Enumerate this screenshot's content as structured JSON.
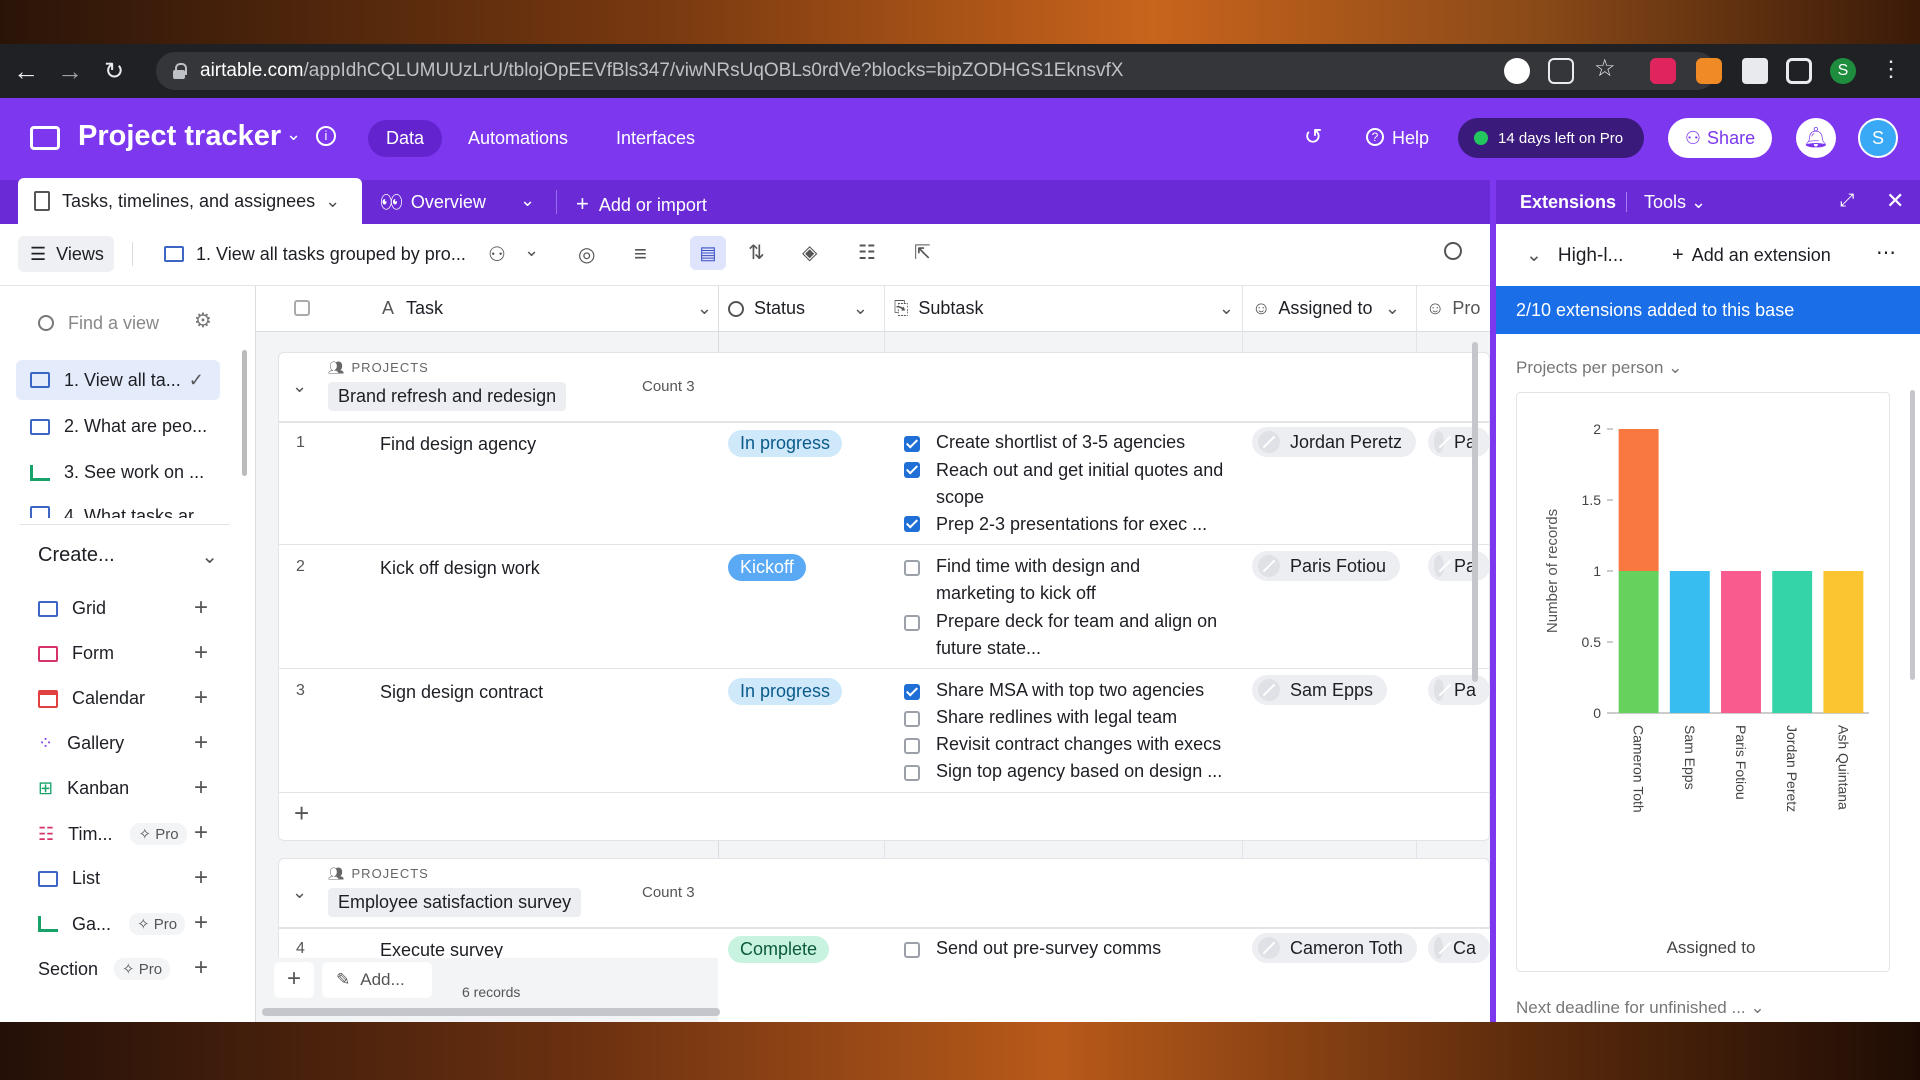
{
  "browser": {
    "url_domain": "airtable.com",
    "url_path": "/appIdhCQLUMUUzLrU/tblojOpEEVfBls347/viwNRsUqOBLs0rdVe?blocks=bipZODHGS1EknsvfX"
  },
  "app": {
    "base_name": "Project tracker",
    "nav": [
      "Data",
      "Automations",
      "Interfaces"
    ],
    "help": "Help",
    "trial": "14 days left on Pro",
    "share": "Share",
    "avatar": "S"
  },
  "tabs": {
    "active": "Tasks, timelines, and assignees",
    "overview": "Overview",
    "add": "Add or import"
  },
  "toolbar": {
    "views": "Views",
    "current_view": "1. View all tasks grouped by pro..."
  },
  "sidebar": {
    "find_placeholder": "Find a view",
    "views": [
      "1. View all ta...",
      "2. What are peo...",
      "3. See work on ...",
      "4. What tasks ar..."
    ],
    "create": "Create...",
    "create_items": [
      {
        "label": "Grid",
        "pro": ""
      },
      {
        "label": "Form",
        "pro": ""
      },
      {
        "label": "Calendar",
        "pro": ""
      },
      {
        "label": "Gallery",
        "pro": ""
      },
      {
        "label": "Kanban",
        "pro": ""
      },
      {
        "label": "Tim...",
        "pro": "Pro"
      },
      {
        "label": "List",
        "pro": ""
      },
      {
        "label": "Ga...",
        "pro": "Pro"
      },
      {
        "label": "Section",
        "pro": "Pro"
      }
    ]
  },
  "grid": {
    "columns": [
      "Task",
      "Status",
      "Subtask",
      "Assigned to",
      "Pro"
    ],
    "groups": [
      {
        "kind": "PROJECTS",
        "name": "Brand refresh and redesign",
        "count": "Count 3"
      },
      {
        "kind": "PROJECTS",
        "name": "Employee satisfaction survey",
        "count": "Count 3"
      }
    ],
    "rows": [
      {
        "num": "1",
        "task": "Find design agency",
        "status": "In progress",
        "assignee": "Jordan Peretz",
        "proj": "Pa",
        "subtasks": [
          {
            "text": "Create shortlist of 3-5 agencies",
            "done": true
          },
          {
            "text": "Reach out and get initial quotes and",
            "done": true
          },
          {
            "text": "scope",
            "done": null
          },
          {
            "text": "Prep 2-3 presentations for exec ...",
            "done": true
          }
        ]
      },
      {
        "num": "2",
        "task": "Kick off design work",
        "status": "Kickoff",
        "assignee": "Paris Fotiou",
        "proj": "Pa",
        "subtasks": [
          {
            "text": "Find time with design and",
            "done": false
          },
          {
            "text": "marketing to kick off",
            "done": null
          },
          {
            "text": "Prepare deck for team and align on",
            "done": false
          },
          {
            "text": "future state...",
            "done": null
          }
        ]
      },
      {
        "num": "3",
        "task": "Sign design contract",
        "status": "In progress",
        "assignee": "Sam Epps",
        "proj": "Pa",
        "subtasks": [
          {
            "text": "Share MSA with top two agencies",
            "done": true
          },
          {
            "text": "Share redlines with legal team",
            "done": false
          },
          {
            "text": "Revisit contract changes with execs",
            "done": false
          },
          {
            "text": "Sign top agency based on design ...",
            "done": false
          }
        ]
      },
      {
        "num": "4",
        "task": "Execute survey",
        "status": "Complete",
        "assignee": "Cameron Toth",
        "proj": "Ca",
        "subtasks": [
          {
            "text": "Send out pre-survey comms",
            "done": false
          }
        ]
      }
    ],
    "footer_add": "Add...",
    "records": "6 records"
  },
  "extensions": {
    "title": "Extensions",
    "tools": "Tools",
    "dashboard": "High-l...",
    "add": "Add an extension",
    "banner": "2/10 extensions added to this base",
    "chart_title": "Projects per person",
    "next_title": "Next deadline for unfinished ..."
  },
  "chart_data": {
    "type": "bar",
    "stacked": true,
    "categories": [
      "Cameron Toth",
      "Sam Epps",
      "Paris Fotiou",
      "Jordan Peretz",
      "Ash Quintana"
    ],
    "series": [
      {
        "values": [
          1,
          1,
          1,
          1,
          1
        ],
        "colors": [
          "#66d15c",
          "#38bdf0",
          "#f95b8f",
          "#35d3a8",
          "#fbc531"
        ]
      },
      {
        "values": [
          1,
          0,
          0,
          0,
          0
        ],
        "colors": [
          "#f8783f"
        ]
      }
    ],
    "ylabel": "Number of records",
    "xlabel": "Assigned to",
    "yticks": [
      "0",
      "0.5",
      "1",
      "1.5",
      "2"
    ],
    "ylim": [
      0,
      2
    ]
  }
}
